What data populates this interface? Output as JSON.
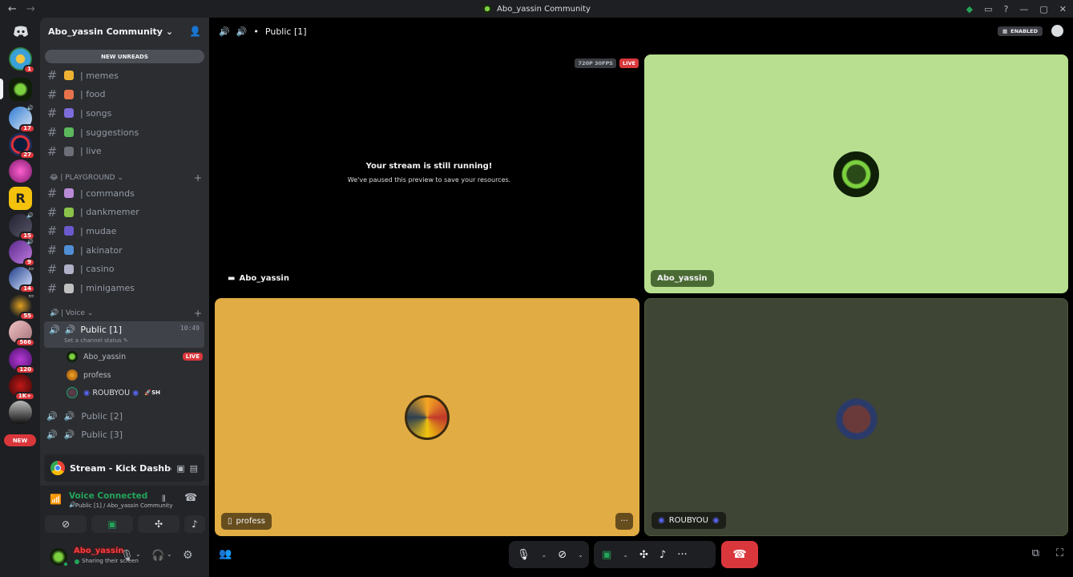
{
  "titlebar": {
    "title": "Abo_yassin Community",
    "back": "←",
    "forward": "→"
  },
  "rail": {
    "badges": [
      "1",
      "17",
      "27",
      "15",
      "9",
      "14",
      "55",
      "566",
      "120",
      "1K+"
    ],
    "new_label": "NEW"
  },
  "sidebar": {
    "guild_name": "Abo_yassin Community",
    "new_unreads": "NEW UNREADS",
    "text_channels": [
      {
        "name": "| memes",
        "emoji_color": "#f0b232"
      },
      {
        "name": "| food",
        "emoji_color": "#e8734b"
      },
      {
        "name": "| songs",
        "emoji_color": "#7b6cd9"
      },
      {
        "name": "| suggestions",
        "emoji_color": "#5cb85c"
      },
      {
        "name": "| live",
        "emoji_color": "#6d6f78"
      }
    ],
    "category_playground": "| PLAYGROUND",
    "playground_channels": [
      {
        "name": "| commands",
        "emoji_color": "#b98bd6"
      },
      {
        "name": "| dankmemer",
        "emoji_color": "#8bc34a"
      },
      {
        "name": "| mudae",
        "emoji_color": "#6a5acd"
      },
      {
        "name": "| akinator",
        "emoji_color": "#4f8fd6"
      },
      {
        "name": "| casino",
        "emoji_color": "#b0b0c8"
      },
      {
        "name": "| minigames",
        "emoji_color": "#c0c0c0"
      }
    ],
    "category_voice": "| Voice",
    "voice_active": {
      "name": "Public [1]",
      "time": "10:49",
      "status": "Set a channel status"
    },
    "members": [
      {
        "name": "Abo_yassin",
        "live": "LIVE"
      },
      {
        "name": "profess"
      },
      {
        "name": "ROUBYOU",
        "tag": "SH"
      }
    ],
    "voice_other": [
      "Public [2]",
      "Public [3]"
    ],
    "stream_panel": {
      "title": "Stream - Kick Dashboard - Go..."
    },
    "voice_connected": {
      "title": "Voice Connected",
      "subtitle": "Public [1] / Abo_yassin Community"
    },
    "user": {
      "name": "Abo_yassin",
      "status": "Sharing their screen"
    }
  },
  "stage": {
    "channel": "Public [1]",
    "enabled_label": "ENABLED",
    "quality": "720P 30FPS",
    "live": "LIVE",
    "paused_title": "Your stream is still running!",
    "paused_sub": "We've paused this preview to save your resources.",
    "tiles": {
      "self": "Abo_yassin",
      "abo": "Abo_yassin",
      "profess": "profess",
      "roubyou": "ROUBYOU"
    },
    "tile_colors": {
      "abo": "#b8df8f",
      "profess": "#e2ac44",
      "roubyou": "#3f4535"
    },
    "more": "···"
  }
}
